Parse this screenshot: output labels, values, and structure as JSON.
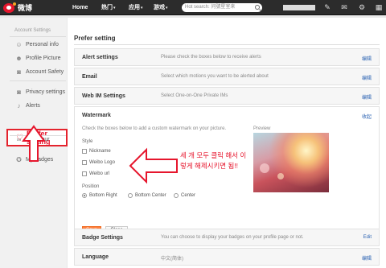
{
  "topbar": {
    "logo_text": "微博",
    "nav": [
      {
        "label": "Home",
        "caret": ""
      },
      {
        "label": "热门",
        "caret": "▾"
      },
      {
        "label": "应用",
        "caret": "▾"
      },
      {
        "label": "游戏",
        "caret": "▾"
      }
    ],
    "search_placeholder": "Hot search: 问號星室来"
  },
  "sidebar": {
    "section_title": "Account Settings",
    "items": [
      {
        "label": "Personal info",
        "icon": "person-icon"
      },
      {
        "label": "Profile Picture",
        "icon": "picture-icon"
      },
      {
        "label": "Account Safety",
        "icon": "lock-icon"
      },
      {
        "label": "Privacy settings",
        "icon": "lock-icon"
      },
      {
        "label": "Alerts",
        "icon": "bell-icon"
      },
      {
        "label": "Prefer setting",
        "icon": "heart-icon"
      },
      {
        "label": "Bind your",
        "icon": "link-icon"
      },
      {
        "label": "My badges",
        "icon": "badge-icon"
      }
    ]
  },
  "main": {
    "title": "Prefer setting",
    "rows": [
      {
        "label": "Alert settings",
        "desc": "Please check the boxes below to receive alerts",
        "action": "编辑"
      },
      {
        "label": "Email",
        "desc": "Select which motions you want to be alerted about",
        "action": "编辑"
      },
      {
        "label": "Web IM Settings",
        "desc": "Select One-on-One Private IMs",
        "action": "编辑"
      }
    ],
    "watermark": {
      "title": "Watermark",
      "collapse": "收起",
      "desc": "Check the boxes below to add a custom watermark on your picture.",
      "preview_label": "Preview",
      "style_label": "Style",
      "style_options": [
        "Nickname",
        "Weibo Logo",
        "Weibo url"
      ],
      "position_label": "Position",
      "position_options": [
        "Bottom Right",
        "Bottom Center",
        "Center"
      ],
      "save": "Save",
      "close": "Close"
    },
    "bottom_rows": [
      {
        "label": "Badge Settings",
        "desc": "You can choose to display your badges on your profile page or not.",
        "action": "Edit"
      },
      {
        "label": "Language",
        "desc": "中文(简体)",
        "action": "编辑"
      }
    ]
  },
  "annotation": {
    "line1": "세 개 모두 클릭 해서 이",
    "line2": "렇게 해제시키면 됨!!",
    "color": "#e6162d"
  }
}
